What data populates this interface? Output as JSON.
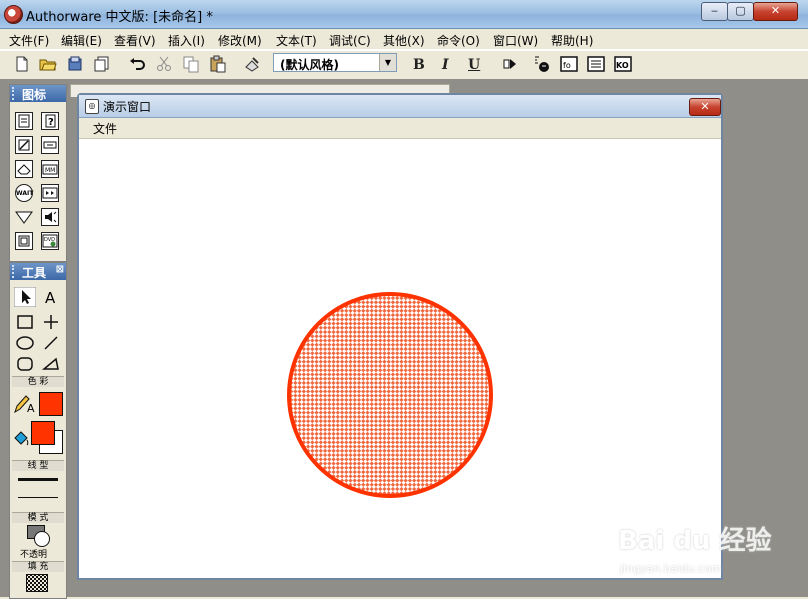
{
  "window": {
    "title": "Authorware 中文版: [未命名] *",
    "controls": {
      "minimize": "‒",
      "maximize": "▢",
      "close": "✕"
    }
  },
  "menubar": {
    "items": [
      "文件(F)",
      "编辑(E)",
      "查看(V)",
      "插入(I)",
      "修改(M)",
      "文本(T)",
      "调试(C)",
      "其他(X)",
      "命令(O)",
      "窗口(W)",
      "帮助(H)"
    ]
  },
  "toolbar": {
    "style_select": "(默认风格)",
    "bold": "B",
    "italic": "I",
    "underline": "U"
  },
  "icon_palette": {
    "title": "图标",
    "icons": [
      "display-icon",
      "interaction-icon",
      "calculation-icon",
      "navigate-icon",
      "erase-icon",
      "movie-icon",
      "wait-icon",
      "video-icon",
      "decision-icon",
      "sound-icon",
      "map-icon",
      "dvd-icon"
    ],
    "wait_label": "WAIT"
  },
  "tools_palette": {
    "title": "工具",
    "sections": {
      "color": "色 彩",
      "line": "线 型",
      "mode": "模 式",
      "fill": "填 充"
    },
    "mode_value": "不透明",
    "colors": {
      "line_color": "#ff3300",
      "fill_fg": "#ff3300",
      "fill_bg": "#ffffff"
    }
  },
  "presentation": {
    "title": "演示窗口",
    "menu_file": "文件",
    "close": "✕"
  },
  "canvas": {
    "shape": "circle",
    "stroke_color": "#ff3300",
    "fill_pattern": "checker"
  },
  "watermark": {
    "text": "Bai du 经验",
    "url": "jingyan.baidu.com"
  }
}
